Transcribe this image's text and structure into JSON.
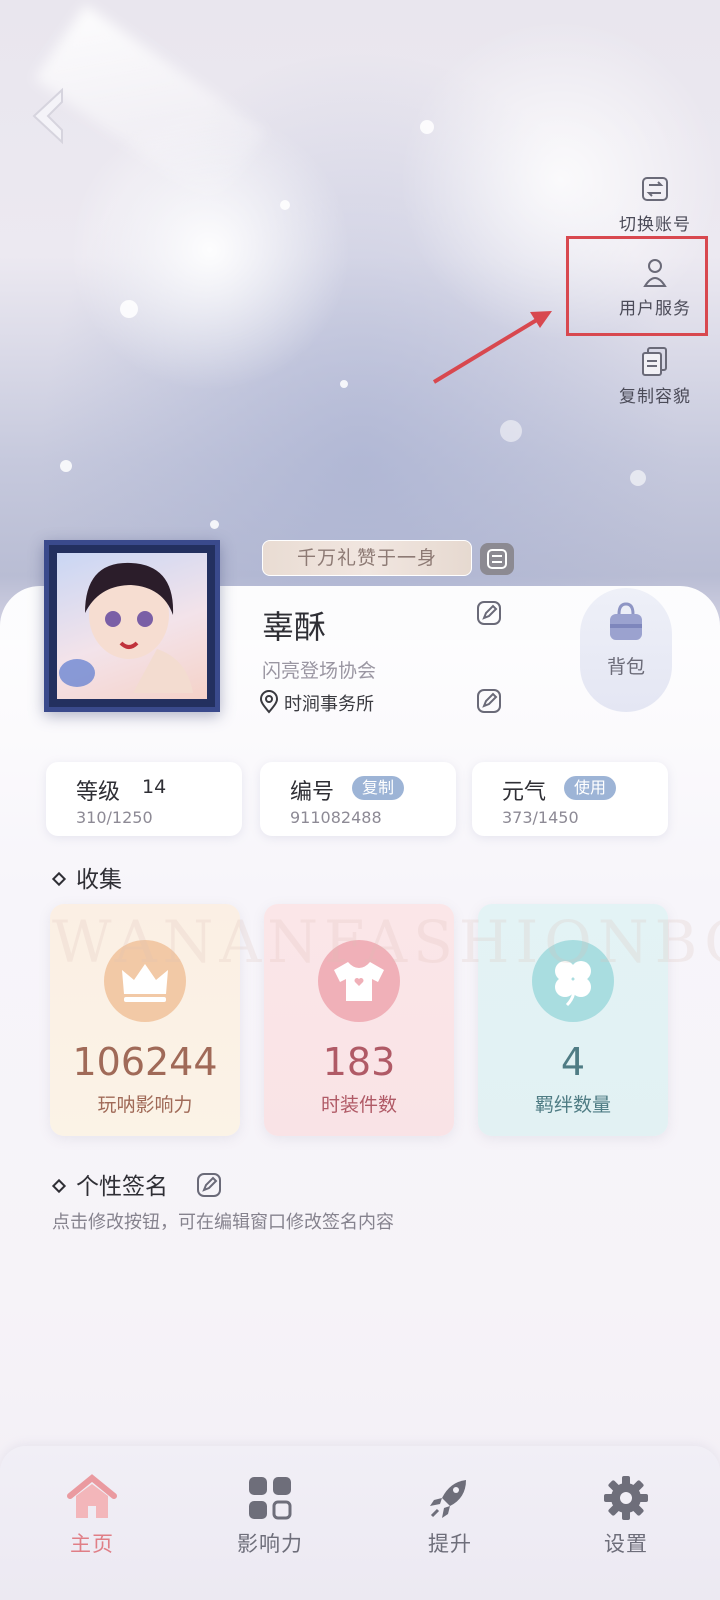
{
  "side_menu": {
    "switch_account": "切换账号",
    "user_service": "用户服务",
    "copy_appearance": "复制容貌"
  },
  "profile": {
    "title_badge": "千万礼赞于一身",
    "nickname": "辜酥",
    "guild": "闪亮登场协会",
    "location": "时涧事务所",
    "bag_label": "背包"
  },
  "stats": {
    "level": {
      "name": "等级",
      "value": "14",
      "progress": "310/1250"
    },
    "id": {
      "name": "编号",
      "action": "复制",
      "value": "911082488"
    },
    "energy": {
      "name": "元气",
      "action": "使用",
      "progress": "373/1450"
    }
  },
  "collection": {
    "title": "收集",
    "watermark": "WANANFASHIONBOND",
    "items": [
      {
        "value": "106244",
        "label": "玩呐影响力",
        "icon": "crown-icon"
      },
      {
        "value": "183",
        "label": "时装件数",
        "icon": "shirt-icon"
      },
      {
        "value": "4",
        "label": "羁绊数量",
        "icon": "clover-icon"
      }
    ]
  },
  "signature": {
    "title": "个性签名",
    "hint": "点击修改按钮，可在编辑窗口修改签名内容"
  },
  "bottom_nav": [
    {
      "label": "主页",
      "icon": "home-icon",
      "active": true
    },
    {
      "label": "影响力",
      "icon": "grid-icon",
      "active": false
    },
    {
      "label": "提升",
      "icon": "rocket-icon",
      "active": false
    },
    {
      "label": "设置",
      "icon": "gear-icon",
      "active": false
    }
  ],
  "colors": {
    "highlight": "#d8484f",
    "active_nav": "#e07e86",
    "pill": "#9db4d6"
  }
}
